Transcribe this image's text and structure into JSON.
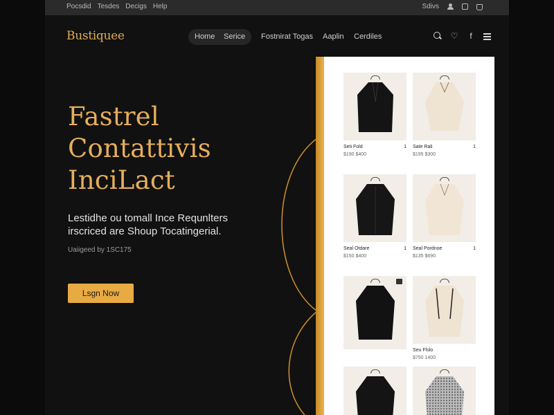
{
  "topbar": {
    "menu": [
      "Pocsdid",
      "Tesdes",
      "Decigs",
      "Help"
    ],
    "right_label": "Sdivs"
  },
  "header": {
    "logo": "Bustiquee",
    "nav": [
      "Home",
      "Serice",
      "Fostnirat Togas",
      "Aaplin",
      "Cerdiles"
    ]
  },
  "hero": {
    "title_lines": [
      "Fastrel",
      "Contattivis",
      "InciLact"
    ],
    "subtitle_lines": [
      "Lestidhe ou tomall Ince Requnlters",
      "irscriced are Shoup Tocatingerial."
    ],
    "meta": "Uaiigeed by 1SC175",
    "cta": "Lsgn Now"
  },
  "products": [
    {
      "name": "Seti Fold",
      "price": "$190 $400",
      "badge": "1"
    },
    {
      "name": "Sate Rali",
      "price": "$195 $300",
      "badge": "1"
    },
    {
      "name": "Seal Otdare",
      "price": "$150 $400",
      "badge": "1"
    },
    {
      "name": "Seal Pordnoe",
      "price": "$135 $690",
      "badge": "1"
    },
    {
      "name": "",
      "price": "",
      "badge": ""
    },
    {
      "name": "Seu Flslo",
      "price": "$750 1400",
      "badge": ""
    },
    {
      "name": "",
      "price": "",
      "badge": ""
    },
    {
      "name": "",
      "price": "",
      "badge": ""
    }
  ],
  "colors": {
    "accent": "#e6ae5c",
    "button": "#e8aa42",
    "background": "#0b0b0b",
    "panel": "#ffffff"
  }
}
